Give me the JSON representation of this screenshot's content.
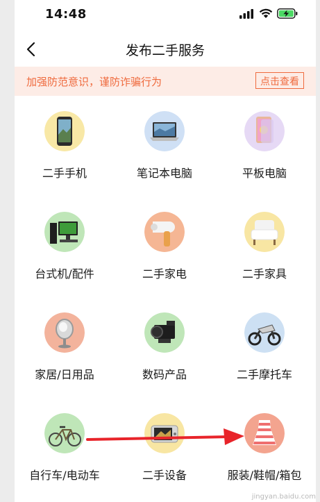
{
  "status_bar": {
    "time": "14:48"
  },
  "header": {
    "title": "发布二手服务",
    "back_icon": "chevron-left-icon"
  },
  "notice": {
    "text": "加强防范意识，谨防诈骗行为",
    "button_label": "点击查看",
    "accent_color": "#ef6a3d",
    "background_color": "#fdece6"
  },
  "categories": [
    {
      "label": "二手手机",
      "icon": "phone-icon"
    },
    {
      "label": "笔记本电脑",
      "icon": "laptop-icon"
    },
    {
      "label": "平板电脑",
      "icon": "tablet-icon"
    },
    {
      "label": "台式机/配件",
      "icon": "desktop-icon"
    },
    {
      "label": "二手家电",
      "icon": "hair-dryer-icon"
    },
    {
      "label": "二手家具",
      "icon": "armchair-icon"
    },
    {
      "label": "家居/日用品",
      "icon": "mirror-icon"
    },
    {
      "label": "数码产品",
      "icon": "camera-icon"
    },
    {
      "label": "二手摩托车",
      "icon": "motorcycle-icon"
    },
    {
      "label": "自行车/电动车",
      "icon": "bicycle-icon"
    },
    {
      "label": "二手设备",
      "icon": "device-icon"
    },
    {
      "label": "服装/鞋帽/箱包",
      "icon": "dress-icon"
    }
  ],
  "annotation": {
    "arrow_color": "#e8242a"
  },
  "watermark": "jingyan.baidu.com"
}
